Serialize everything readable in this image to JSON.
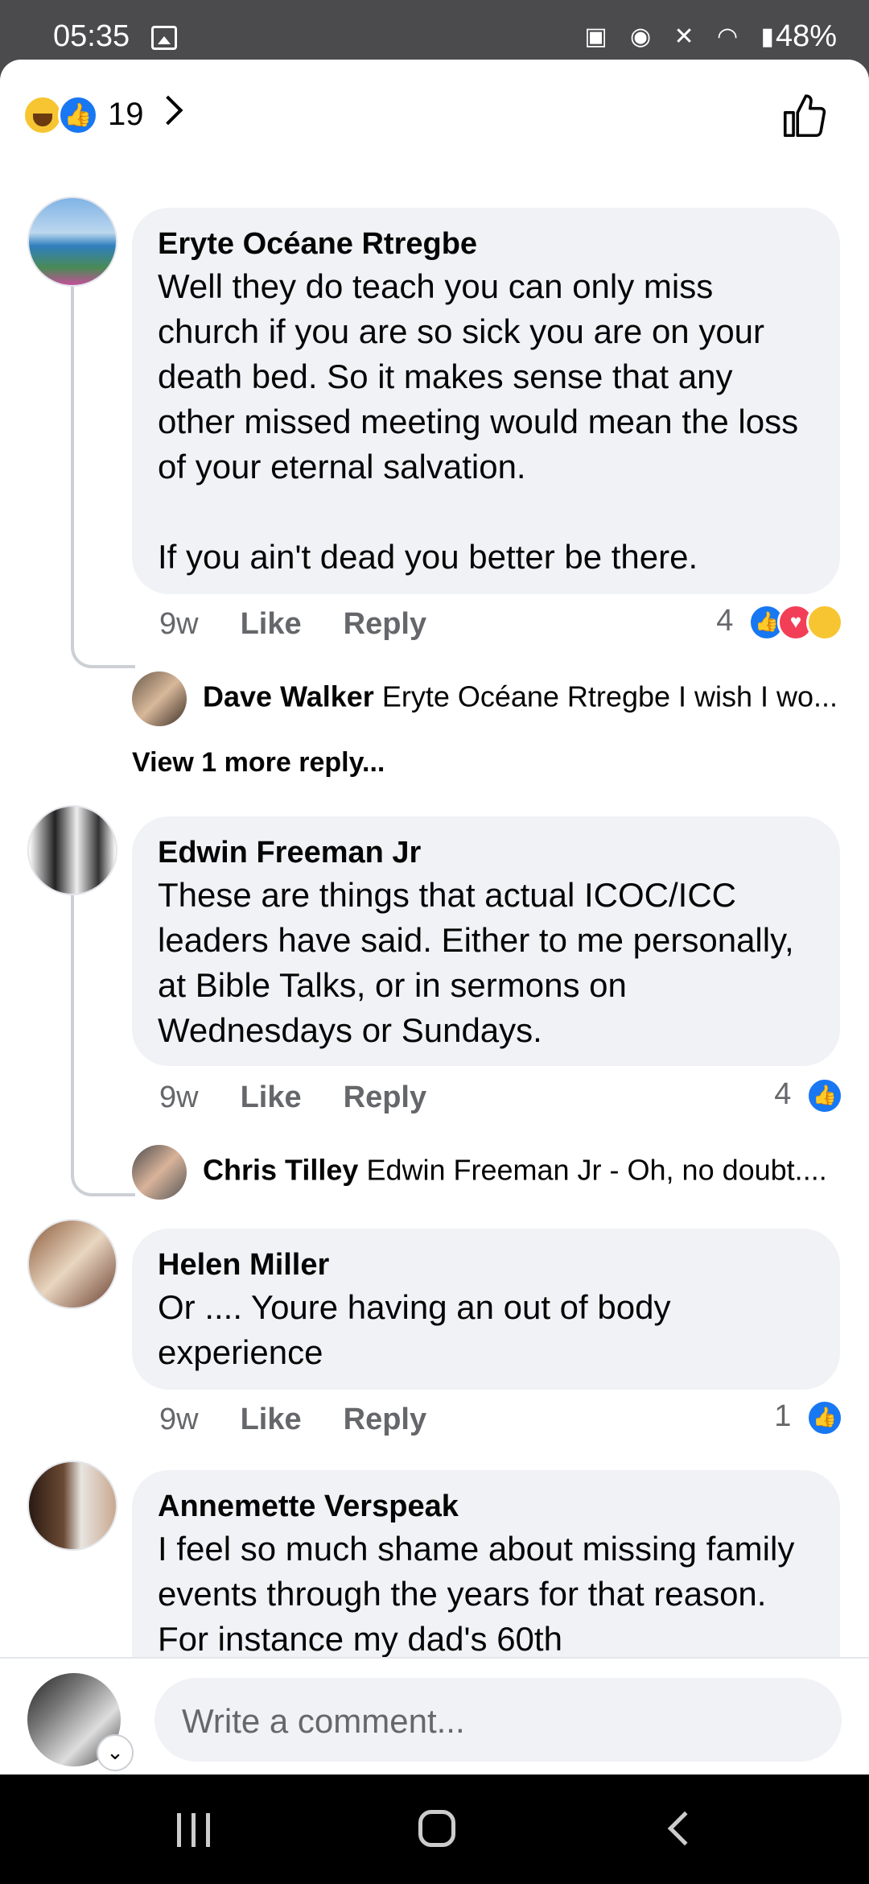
{
  "status_bar": {
    "time": "05:35",
    "battery": "48%"
  },
  "header": {
    "reaction_count": "19"
  },
  "comments": [
    {
      "author": "Eryte Océane Rtregbe",
      "text": "Well they do teach you can only miss church if you are so sick you are on your death bed. So it makes sense that any other missed meeting would mean the loss of your eternal salvation.\n\nIf you ain't dead you better be there.",
      "age": "9w",
      "like": "Like",
      "reply": "Reply",
      "reactions": "4",
      "reply_preview": {
        "name": "Dave Walker",
        "text": "Eryte Océane Rtregbe I wish I wo..."
      },
      "more": "View 1 more reply..."
    },
    {
      "author": "Edwin Freeman Jr",
      "text": "These are things that actual ICOC/ICC leaders have said. Either to me personally, at Bible Talks, or in sermons on Wednesdays or Sundays.",
      "age": "9w",
      "like": "Like",
      "reply": "Reply",
      "reactions": "4",
      "reply_preview": {
        "name": "Chris Tilley",
        "text": "Edwin Freeman Jr - Oh, no doubt...."
      }
    },
    {
      "author": "Helen Miller",
      "text": "Or .... Youre having an out of body experience",
      "age": "9w",
      "like": "Like",
      "reply": "Reply",
      "reactions": "1"
    },
    {
      "author": "Annemette Verspeak",
      "text": "I feel so much shame about missing family events through the years for that reason. For instance my dad's 60th"
    }
  ],
  "composer": {
    "placeholder": "Write a comment..."
  },
  "colors": {
    "accent": "#1877f2",
    "bubble": "#f0f2f5",
    "secondary_text": "#65676b"
  }
}
